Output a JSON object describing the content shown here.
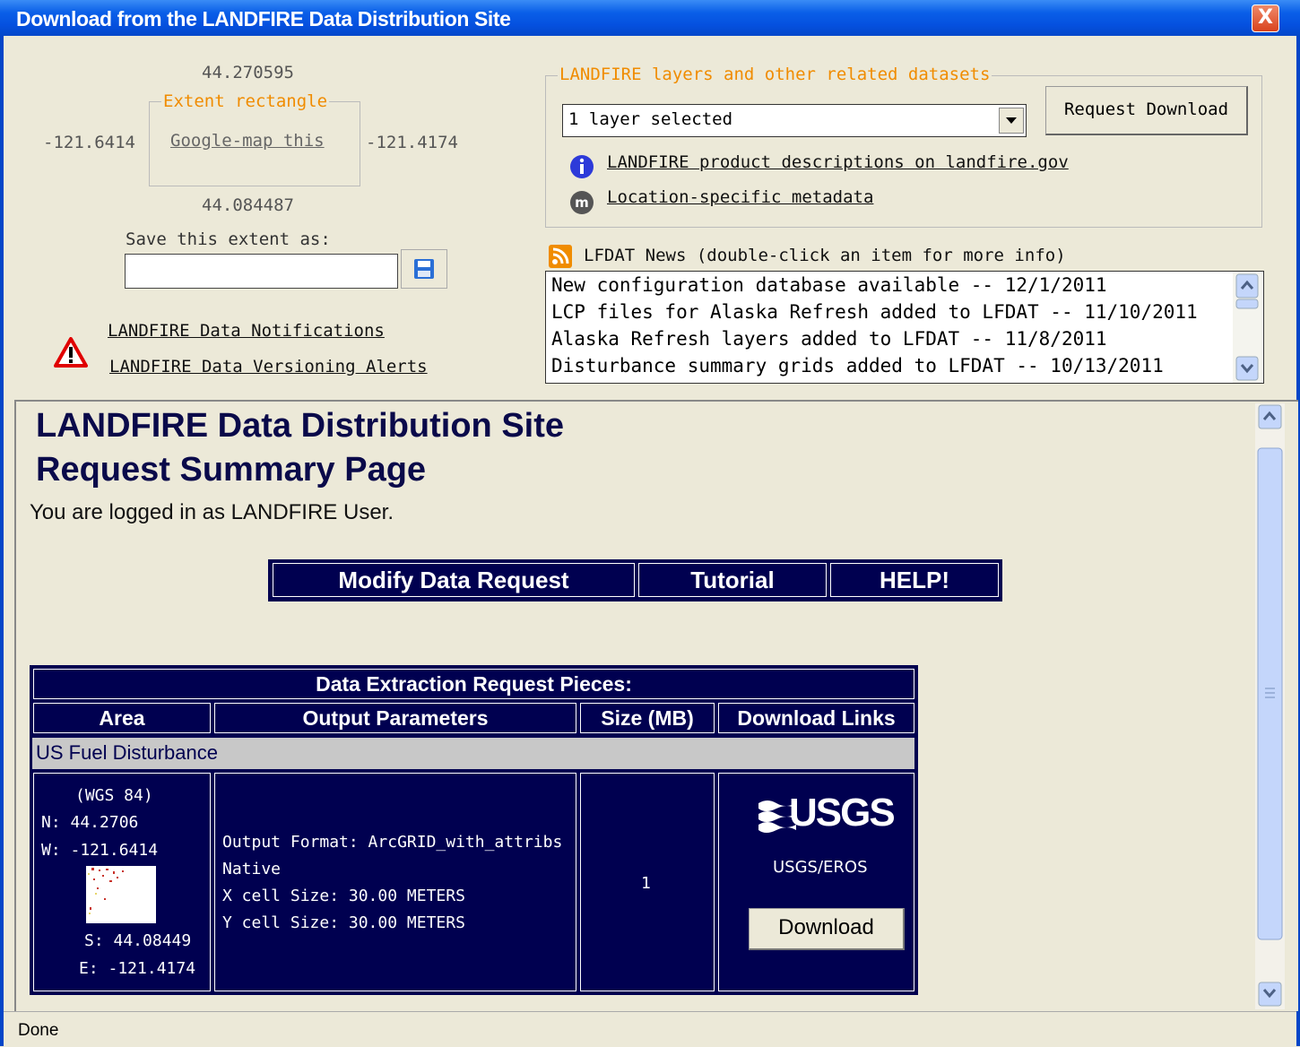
{
  "window": {
    "title": "Download from the LANDFIRE Data Distribution Site",
    "close_glyph": "X"
  },
  "extent": {
    "north": "44.270595",
    "south": "44.084487",
    "west": "-121.6414",
    "east": "-121.4174",
    "legend": "Extent rectangle",
    "map_link": "Google-map this",
    "save_label": "Save this extent as:",
    "save_value": ""
  },
  "alerts": {
    "notifications": "LANDFIRE Data Notifications",
    "versioning": "LANDFIRE Data Versioning Alerts"
  },
  "layers": {
    "legend": "LANDFIRE layers and other related datasets",
    "selected": "1 layer selected",
    "request_button": "Request Download",
    "product_link": "LANDFIRE product descriptions on landfire.gov",
    "metadata_link": "Location-specific metadata"
  },
  "news": {
    "label": "LFDAT News (double-click an item for more info)",
    "items": [
      "New configuration database available -- 12/1/2011",
      "LCP files for Alaska Refresh added to LFDAT -- 11/10/2011",
      "Alaska Refresh layers added to LFDAT -- 11/8/2011",
      "Disturbance summary grids added to LFDAT -- 10/13/2011"
    ]
  },
  "page": {
    "heading1": "LANDFIRE Data Distribution Site",
    "heading2": "Request Summary Page",
    "logged_in": "You are logged in as LANDFIRE User.",
    "nav": [
      "Modify Data Request",
      "Tutorial",
      "HELP!"
    ]
  },
  "table": {
    "title": "Data Extraction Request Pieces:",
    "columns": [
      "Area",
      "Output Parameters",
      "Size (MB)",
      "Download Links"
    ],
    "group": "US Fuel Disturbance",
    "area": {
      "datum": "(WGS 84)",
      "n": "N: 44.2706",
      "w": "W: -121.6414",
      "s": "S: 44.08449",
      "e": "E: -121.4174"
    },
    "params": [
      "Output Format: ArcGRID_with_attribs",
      "Native",
      "X cell Size: 30.00 METERS",
      "Y cell Size: 30.00 METERS"
    ],
    "size": "1",
    "logo_text": "USGS",
    "provider": "USGS/EROS",
    "download_button": "Download"
  },
  "status": {
    "text": "Done"
  },
  "colors": {
    "titlebar": "#0550df",
    "navy": "#000050",
    "accent_orange": "#f08c00"
  }
}
